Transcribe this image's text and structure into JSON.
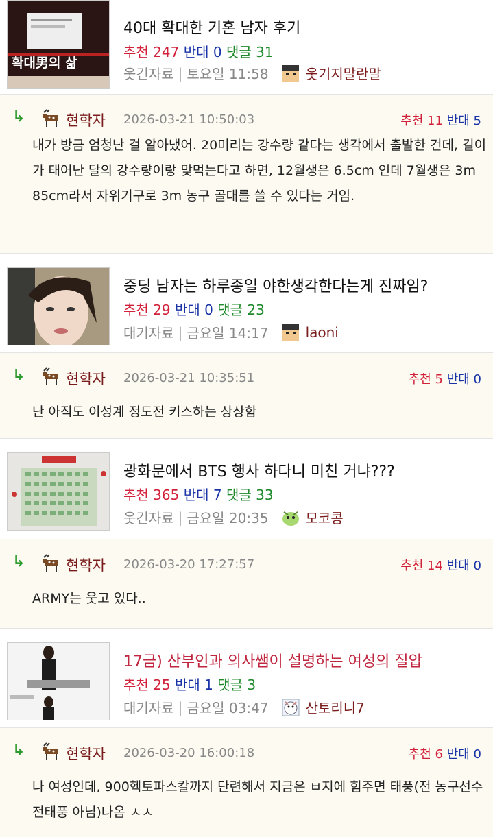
{
  "posts": [
    {
      "title": "40대 확대한 기혼 남자 후기",
      "rec_label": "추천",
      "rec": "247",
      "opp_label": "반대",
      "opp": "0",
      "cmt_label": "댓글",
      "cmt": "31",
      "category": "웃긴자료",
      "time": "토요일 11:58",
      "author": "웃기지말란말",
      "thumb_text": "확대男의 삶",
      "reply": {
        "author": "현학자",
        "date": "2026-03-21 10:50:03",
        "rec_label": "추천",
        "rec": "11",
        "opp_label": "반대",
        "opp": "5",
        "body": "내가 방금 엄청난 걸 알아냈어. 20미리는 강수량 같다는 생각에서 출발한 건데, 길이가 태어난 달의 강수량이랑 맞먹는다고 하면, 12월생은 6.5cm 인데 7월생은 3m 85cm라서 자위기구로 3m 농구 골대를 쓸 수 있다는 거임."
      }
    },
    {
      "title": "중딩 남자는 하루종일 야한생각한다는게 진짜임?",
      "rec_label": "추천",
      "rec": "29",
      "opp_label": "반대",
      "opp": "0",
      "cmt_label": "댓글",
      "cmt": "23",
      "category": "대기자료",
      "time": "금요일 14:17",
      "author": "laoni",
      "reply": {
        "author": "현학자",
        "date": "2026-03-21 10:35:51",
        "rec_label": "추천",
        "rec": "5",
        "opp_label": "반대",
        "opp": "0",
        "body": "난 아직도 이성계 정도전 키스하는 상상함"
      }
    },
    {
      "title": "광화문에서 BTS 행사 하다니 미친 거냐???",
      "rec_label": "추천",
      "rec": "365",
      "opp_label": "반대",
      "opp": "7",
      "cmt_label": "댓글",
      "cmt": "33",
      "category": "웃긴자료",
      "time": "금요일 20:35",
      "author": "모코콩",
      "reply": {
        "author": "현학자",
        "date": "2026-03-20 17:27:57",
        "rec_label": "추천",
        "rec": "14",
        "opp_label": "반대",
        "opp": "0",
        "body": "ARMY는 웃고 있다.."
      }
    },
    {
      "title": "17금) 산부인과 의사쌤이 설명하는 여성의 질압",
      "rec_label": "추천",
      "rec": "25",
      "opp_label": "반대",
      "opp": "1",
      "cmt_label": "댓글",
      "cmt": "3",
      "category": "대기자료",
      "time": "금요일 03:47",
      "author": "산토리니7",
      "reply": {
        "author": "현학자",
        "date": "2026-03-20 16:00:18",
        "rec_label": "추천",
        "rec": "6",
        "opp_label": "반대",
        "opp": "0",
        "body": "나 여성인데, 900헥토파스칼까지 단련해서 지금은 ㅂ지에 힘주면 태풍(전 농구선수 전태풍 아님)나옴 ㅅㅅ"
      }
    }
  ],
  "colors": {
    "recommend": "#d2213a",
    "oppose": "#1a34a8",
    "comment": "#1f8a2b",
    "author": "#7a1c1c",
    "reply_bg": "#fcfaf1"
  },
  "icons": {
    "reply": "reply-arrow-icon",
    "deer": "deer-icon",
    "avatar": "user-avatar-icon"
  }
}
